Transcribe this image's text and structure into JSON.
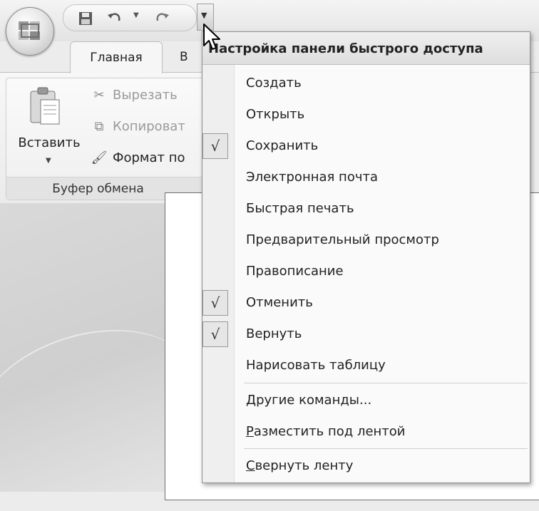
{
  "quick_access_toolbar": {
    "icons": [
      "save-icon",
      "undo-icon",
      "redo-icon",
      "customize-dropdown-icon"
    ]
  },
  "ribbon": {
    "tabs": [
      {
        "label": "Главная",
        "active": true
      },
      {
        "label": "В",
        "active": false
      }
    ],
    "clipboard_group": {
      "paste_label": "Вставить",
      "cut_label": "Вырезать",
      "copy_label": "Копироват",
      "format_label": "Формат по",
      "group_label": "Буфер обмена"
    }
  },
  "customize_menu": {
    "title": "Настройка панели быстрого доступа",
    "items": [
      {
        "label": "Создать",
        "checked": false
      },
      {
        "label": "Открыть",
        "checked": false
      },
      {
        "label": "Сохранить",
        "checked": true
      },
      {
        "label": "Электронная почта",
        "checked": false
      },
      {
        "label": "Быстрая печать",
        "checked": false
      },
      {
        "label": "Предварительный просмотр",
        "checked": false
      },
      {
        "label": "Правописание",
        "checked": false
      },
      {
        "label": "Отменить",
        "checked": true
      },
      {
        "label": "Вернуть",
        "checked": true
      },
      {
        "label": "Нарисовать таблицу",
        "checked": false
      }
    ],
    "more_commands": {
      "accel": "Д",
      "rest": "ругие команды..."
    },
    "place_below": {
      "accel": "Р",
      "rest": "азместить под лентой"
    },
    "minimize_ribbon": {
      "accel": "С",
      "rest": "вернуть ленту"
    },
    "check_glyph": "√"
  }
}
